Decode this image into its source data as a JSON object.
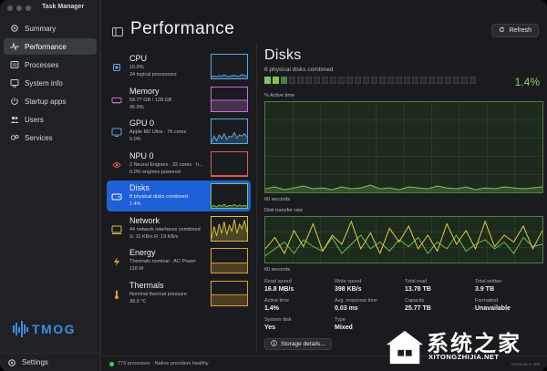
{
  "app": {
    "title": "Task Manager"
  },
  "nav": {
    "items": [
      {
        "label": "Summary",
        "icon": "gear-icon"
      },
      {
        "label": "Performance",
        "icon": "pulse-icon"
      },
      {
        "label": "Processes",
        "icon": "list-icon"
      },
      {
        "label": "System info",
        "icon": "info-icon"
      },
      {
        "label": "Startup apps",
        "icon": "power-icon"
      },
      {
        "label": "Users",
        "icon": "users-icon"
      },
      {
        "label": "Services",
        "icon": "services-icon"
      }
    ],
    "active": "Performance",
    "settings_label": "Settings"
  },
  "logo": {
    "text": "TMOG"
  },
  "header": {
    "title": "Performance",
    "refresh_label": "Refresh"
  },
  "devices": [
    {
      "name": "CPU",
      "line1": "15.9%",
      "line2": "24 logical processors",
      "color": "#5ba7e6",
      "icon": "cpu-icon",
      "graph": [
        0.08,
        0.1,
        0.07,
        0.12,
        0.09,
        0.15,
        0.1,
        0.08,
        0.11,
        0.13,
        0.09,
        0.1,
        0.16,
        0.12,
        0.1
      ]
    },
    {
      "name": "Memory",
      "line1": "58.77 GB / 128 GB",
      "line2": "45.9%",
      "color": "#c86ee0",
      "icon": "memory-icon",
      "graph": [
        0.46,
        0.46,
        0.46,
        0.46,
        0.46,
        0.46,
        0.46,
        0.46,
        0.46,
        0.46,
        0.46,
        0.46,
        0.46,
        0.46,
        0.46
      ]
    },
    {
      "name": "GPU 0",
      "line1": "Apple M2 Ultra · 76 cores",
      "line2": "0.0%",
      "color": "#5ba7e6",
      "icon": "gpu-icon",
      "graph": [
        0.05,
        0.3,
        0.1,
        0.35,
        0.2,
        0.4,
        0.15,
        0.3,
        0.25,
        0.45,
        0.2,
        0.35,
        0.3,
        0.4,
        0.25
      ]
    },
    {
      "name": "NPU 0",
      "line1": "2 Neural Engines · 32 cores · h...",
      "line2": "0.0% engines powered",
      "color": "#e05a5a",
      "icon": "npu-icon",
      "graph": [
        0.02,
        0.02,
        0.02,
        0.02,
        0.02,
        0.02,
        0.02,
        0.02,
        0.02,
        0.02,
        0.02,
        0.02,
        0.02,
        0.02,
        0.02
      ]
    },
    {
      "name": "Disks",
      "line1": "8 physical disks combined",
      "line2": "1.4%",
      "color": "#7ec45a",
      "icon": "disk-icon",
      "graph": [
        0.05,
        0.1,
        0.04,
        0.12,
        0.06,
        0.15,
        0.05,
        0.1,
        0.08,
        0.14,
        0.06,
        0.12,
        0.07,
        0.1,
        0.06
      ]
    },
    {
      "name": "Network",
      "line1": "44 network interfaces combined",
      "line2": "S: 11 KB/s  R: 19 KB/s",
      "color": "#d9c23a",
      "icon": "network-icon",
      "graph": [
        0.1,
        0.6,
        0.2,
        0.7,
        0.3,
        0.8,
        0.25,
        0.65,
        0.4,
        0.9,
        0.3,
        0.7,
        0.5,
        0.85,
        0.35
      ]
    },
    {
      "name": "Energy",
      "line1": "Thermals nominal · AC Power",
      "line2": "118 W",
      "color": "#e0a030",
      "icon": "energy-icon",
      "graph": [
        0.4,
        0.4,
        0.4,
        0.4,
        0.4,
        0.4,
        0.4,
        0.4,
        0.4,
        0.4,
        0.4,
        0.4,
        0.4,
        0.4,
        0.4
      ]
    },
    {
      "name": "Thermals",
      "line1": "Nominal thermal pressure",
      "line2": "39.9 °C",
      "color": "#e0a030",
      "icon": "thermometer-icon",
      "graph": [
        0.45,
        0.45,
        0.45,
        0.45,
        0.45,
        0.45,
        0.45,
        0.45,
        0.45,
        0.45,
        0.45,
        0.45,
        0.45,
        0.45,
        0.45
      ]
    }
  ],
  "detail": {
    "title": "Disks",
    "subtitle": "8 physical disks combined",
    "percent": "1.4%",
    "segments_on": 3,
    "segments_total": 26,
    "graph1_label": "% Active time",
    "graph1_time": "60 seconds",
    "graph2_label": "Disk transfer rate",
    "graph2_time": "60 seconds",
    "active_series": [
      0.04,
      0.06,
      0.03,
      0.05,
      0.07,
      0.04,
      0.05,
      0.03,
      0.06,
      0.04,
      0.05,
      0.08,
      0.04,
      0.05,
      0.03,
      0.06,
      0.05,
      0.04,
      0.07,
      0.05,
      0.04,
      0.06,
      0.03,
      0.05,
      0.04,
      0.06,
      0.05,
      0.04,
      0.05,
      0.06
    ],
    "read_series": [
      0.3,
      0.55,
      0.2,
      0.7,
      0.35,
      0.85,
      0.25,
      0.6,
      0.4,
      0.9,
      0.3,
      0.65,
      0.2,
      0.75,
      0.45,
      0.8,
      0.3,
      0.6,
      0.25,
      0.85,
      0.4,
      0.7,
      0.3,
      0.9,
      0.35,
      0.6,
      0.45,
      0.8,
      0.3,
      0.7
    ],
    "write_series": [
      0.15,
      0.3,
      0.45,
      0.2,
      0.5,
      0.35,
      0.25,
      0.55,
      0.2,
      0.4,
      0.6,
      0.3,
      0.45,
      0.25,
      0.5,
      0.35,
      0.55,
      0.2,
      0.45,
      0.3,
      0.6,
      0.25,
      0.4,
      0.5,
      0.3,
      0.45,
      0.2,
      0.55,
      0.35,
      0.4
    ],
    "stats": [
      {
        "label": "Read speed",
        "value": "16.8 MB/s"
      },
      {
        "label": "Write speed",
        "value": "398 KB/s"
      },
      {
        "label": "Total read",
        "value": "13.78 TB"
      },
      {
        "label": "Total written",
        "value": "3.9 TB"
      },
      {
        "label": "Active time",
        "value": "1.4%"
      },
      {
        "label": "Avg. response time",
        "value": "0.03 ms"
      },
      {
        "label": "Capacity",
        "value": "25.77 TB"
      },
      {
        "label": "Formatted",
        "value": "Unavailable"
      },
      {
        "label": "System disk",
        "value": "Yes"
      },
      {
        "label": "Type",
        "value": "Mixed"
      }
    ],
    "storage_button": "Storage details..."
  },
  "status": {
    "text": "773 processes · Native providers healthy",
    "generation": "Generation 368"
  },
  "watermark": {
    "text": "系统之家",
    "url": "XITONGZHIJIA.NET"
  },
  "colors": {
    "accent": "#1f5fd8",
    "disk_green": "#7ec45a",
    "read_yellow": "#e0d040",
    "write_green": "#6fbf4a"
  }
}
